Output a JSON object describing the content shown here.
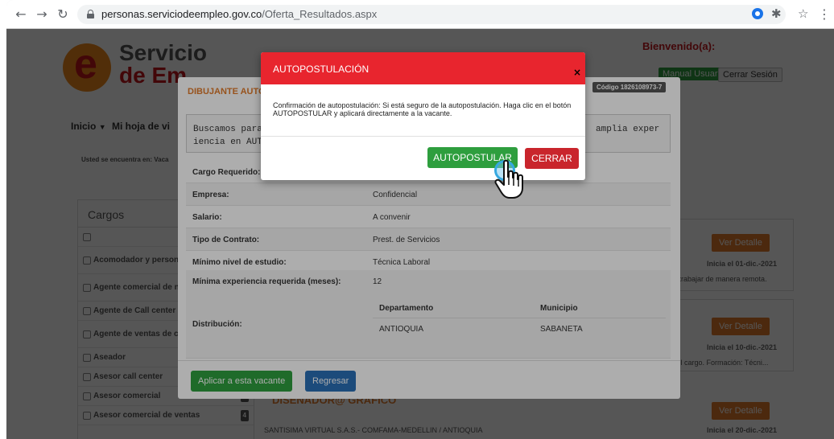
{
  "browser": {
    "url_domain": "personas.serviciodeempleo.gov.co",
    "url_path": "/Oferta_Resultados.aspx",
    "back_glyph": "←",
    "forward_glyph": "→",
    "reload_glyph": "↻",
    "star_glyph": "☆",
    "extensions_glyph": "✱",
    "menu_glyph": "⋮"
  },
  "background": {
    "logo_line1": "Servicio",
    "logo_line2": "de Em",
    "logo2_fragment": "",
    "bienvenido": "Bienvenido(a):",
    "manual_usuario": "Manual Usuario",
    "cerrar_sesion": "Cerrar Sesión",
    "nav_inicio": "Inicio",
    "nav_hoja": "Mi hoja de vi",
    "breadcrumb": "Usted se encuentra en:  Vaca",
    "cargos_title": "Cargos",
    "cargos": [
      {
        "label": ""
      },
      {
        "label": "Acomodador y persona auxiliar"
      },
      {
        "label": "Agente comercial de negocios"
      },
      {
        "label": "Agente de Call center"
      },
      {
        "label": "Agente de ventas de ca center"
      },
      {
        "label": "Aseador"
      },
      {
        "label": "Asesor call center"
      },
      {
        "label": "Asesor comercial",
        "count": "1"
      },
      {
        "label": "Asesor comercial de ventas",
        "count": "4"
      }
    ],
    "ver_detalle": "Ver Detalle",
    "cards": [
      {
        "inicia": "Inicia el 01-dic.-2021",
        "snippet": "ara trabajar de manera remota."
      },
      {
        "inicia": "Inicia el 10-dic.-2021",
        "snippet": "en el cargo. Formación: Técni..."
      },
      {
        "inicia": "Inicia el 20-dic.-2021",
        "snippet": ""
      }
    ],
    "disenador": "DISEÑADOR@ GRÁFICO",
    "santisima": "SANTISIMA VIRTUAL S.A.S.- COMFAMA-MEDELLIN / ANTIOQUIA"
  },
  "detail_modal": {
    "title": "DIBUJANTE AUTO",
    "codigo": "Código 1826108973-7",
    "description_left_line1": "Buscamos para",
    "description_left_line2": "iencia en AUTO",
    "description_right": "amplia exper",
    "rows": [
      {
        "label": "Cargo Requerido:",
        "value": ""
      },
      {
        "label": "Empresa:",
        "value": "Confidencial"
      },
      {
        "label": "Salario:",
        "value": "A convenir"
      },
      {
        "label": "Tipo de Contrato:",
        "value": "Prest. de Servicios"
      },
      {
        "label": "Mínimo nivel de estudio:",
        "value": "Técnica Laboral"
      },
      {
        "label": "Mínima experiencia requerida (meses):",
        "value": "12"
      }
    ],
    "distribucion_label": "Distribución:",
    "dist_header_departamento": "Departamento",
    "dist_header_municipio": "Municipio",
    "dist_departamento": "ANTIOQUIA",
    "dist_municipio": "SABANETA",
    "aplicar": "Aplicar a esta vacante",
    "regresar": "Regresar"
  },
  "auto_modal": {
    "title": "AUTOPOSTULACIÓN",
    "close": "×",
    "message": "Confirmación de autopostulación: Si está seguro de la autopostulación. Haga clic en el botón AUTOPOSTULAR y aplicará directamente a la vacante.",
    "autopostular": "AUTOPOSTULAR",
    "cerrar": "CERRAR"
  },
  "colors": {
    "header_red": "#e8252e",
    "button_green": "#2e9e3e",
    "button_red": "#c9252c",
    "button_blue": "#2a6fb5",
    "accent_orange": "#e07b2c"
  },
  "icons": {
    "cursor": "hand-pointer-icon",
    "click_highlight": "click-ring-icon"
  }
}
